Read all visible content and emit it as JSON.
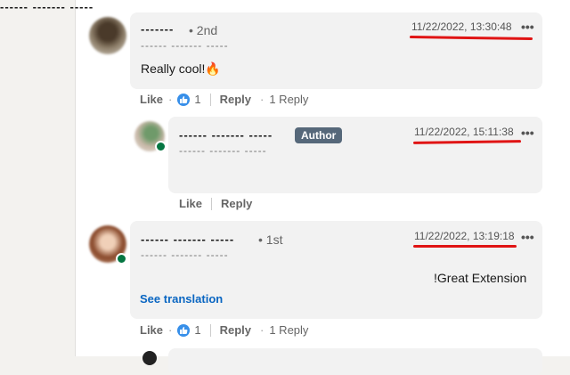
{
  "comments": [
    {
      "name": "-------",
      "degree": "• 2nd",
      "headline": "------ ------- -----",
      "timestamp": "11/22/2022, 13:30:48",
      "menu": "•••",
      "text": "Really cool!🔥",
      "actions": {
        "like": "Like",
        "like_count": "1",
        "reply": "Reply",
        "replies": "1 Reply"
      }
    },
    {
      "name": "------ ------- -----",
      "badge": "Author",
      "headline": "------ ------- -----",
      "timestamp": "11/22/2022, 15:11:38",
      "menu": "•••",
      "text": "------ ------- -----",
      "actions": {
        "like": "Like",
        "reply": "Reply"
      }
    },
    {
      "name": "------ ------- -----",
      "degree": "• 1st",
      "headline": "------ ------- -----",
      "timestamp": "11/22/2022, 13:19:18",
      "menu": "•••",
      "text": "!Great Extension",
      "translation": "See translation",
      "actions": {
        "like": "Like",
        "like_count": "1",
        "reply": "Reply",
        "replies": "1 Reply"
      }
    }
  ],
  "colors": {
    "annotation_underline": "#e01414",
    "presence_online": "#057642",
    "link_blue": "#0a66c2",
    "author_badge": "#56687a",
    "bubble_bg": "#f2f2f2"
  }
}
